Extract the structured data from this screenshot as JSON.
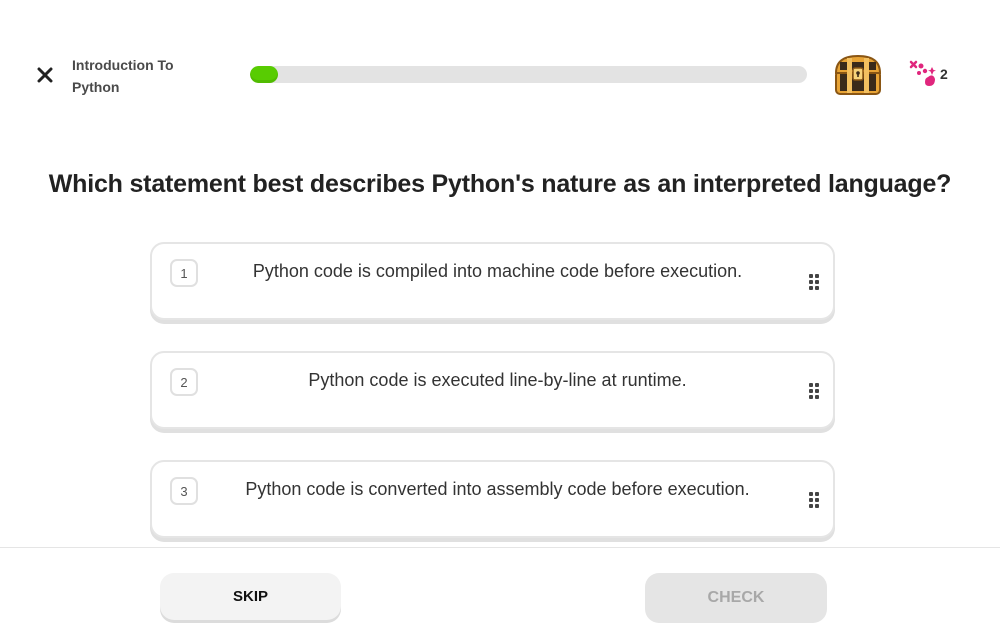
{
  "header": {
    "lesson_title": "Introduction To Python",
    "progress_percent": 5,
    "gems_count": "2"
  },
  "question": {
    "text": "Which statement best describes Python's nature as an interpreted language?"
  },
  "options": [
    {
      "number": "1",
      "text": "Python code is compiled into machine code before execution."
    },
    {
      "number": "2",
      "text": "Python code is executed line-by-line at runtime."
    },
    {
      "number": "3",
      "text": "Python code is converted into assembly code before execution."
    }
  ],
  "footer": {
    "skip_label": "SKIP",
    "check_label": "CHECK"
  },
  "colors": {
    "progress_fill": "#58cc02",
    "gem": "#e0267d",
    "chest_gold": "#e8a436"
  }
}
